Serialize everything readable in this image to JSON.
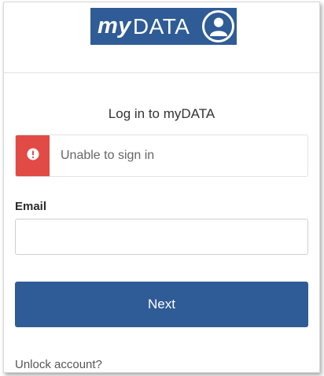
{
  "logo": {
    "my": "my",
    "data": "DATA",
    "icon": "user-circle-icon"
  },
  "title": "Log in to myDATA",
  "error": {
    "icon": "exclamation-icon",
    "message": "Unable to sign in",
    "color": "#e24a45"
  },
  "email": {
    "label": "Email",
    "value": "",
    "placeholder": ""
  },
  "next_button": {
    "label": "Next",
    "color": "#2f5c96"
  },
  "unlock_link": "Unlock account?"
}
